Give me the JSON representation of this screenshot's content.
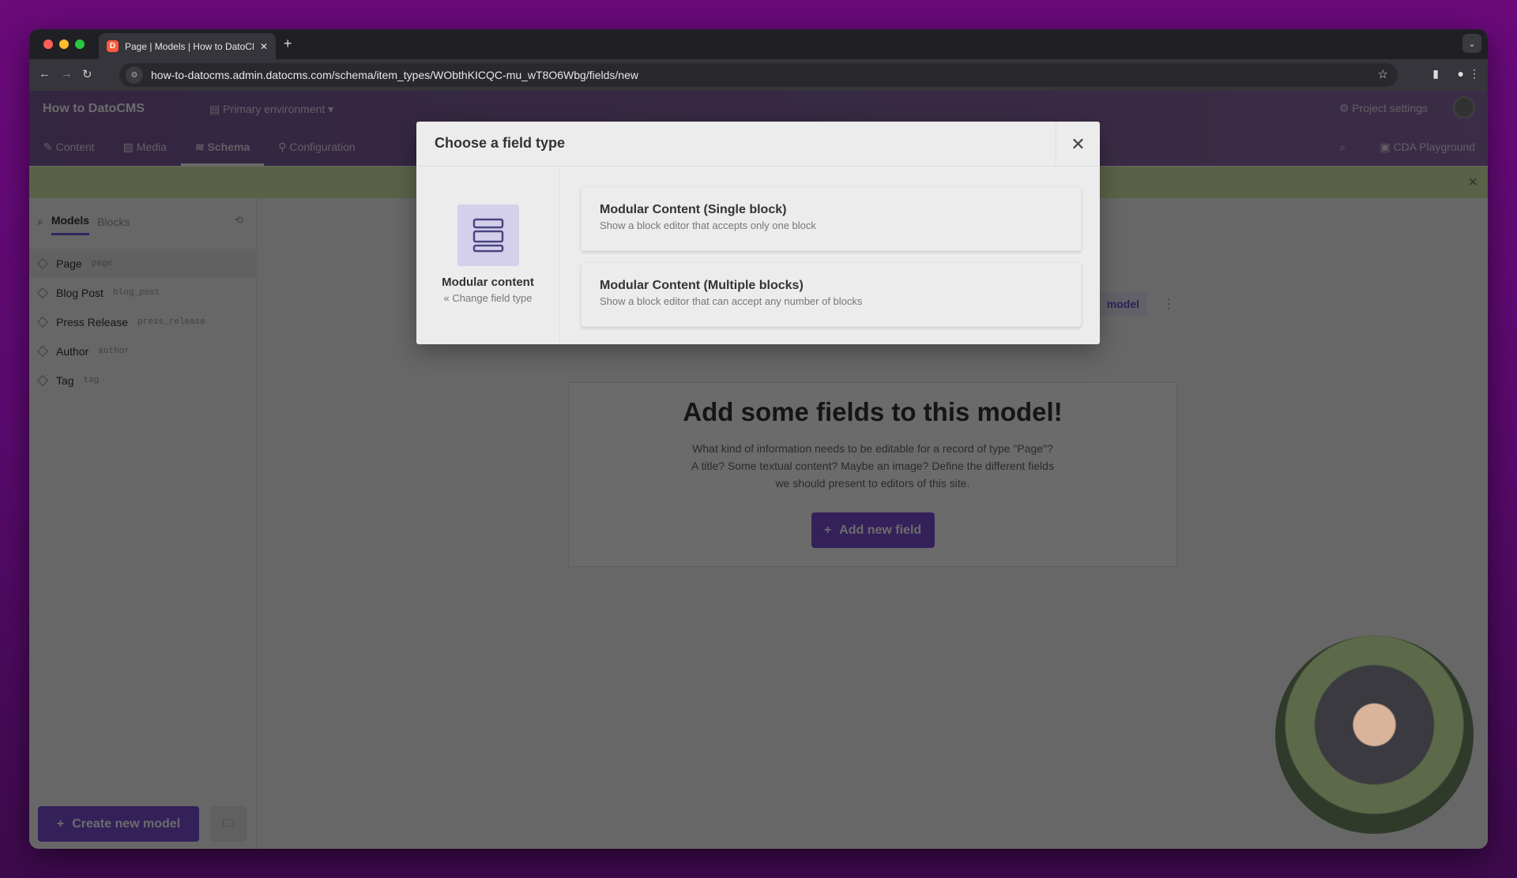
{
  "browser": {
    "tab_title": "Page | Models | How to DatoCMS",
    "favicon": "D",
    "new_tab": "+",
    "url": "how-to-datocms.admin.datocms.com/schema/item_types/WObthKICQC-mu_wT8O6Wbg/fields/new",
    "colors": {
      "close": "#ff5f57",
      "minimize": "#febc2e",
      "maximize": "#28c840"
    }
  },
  "header": {
    "project": "How to DatoCMS",
    "environment": "Primary environment",
    "project_settings": "Project settings",
    "cda_playground": "CDA Playground"
  },
  "nav": {
    "tabs": [
      {
        "label": "Content"
      },
      {
        "label": "Media"
      },
      {
        "label": "Schema"
      },
      {
        "label": "Configuration"
      }
    ]
  },
  "sidebar": {
    "tabs": [
      "Models",
      "Blocks"
    ],
    "items": [
      {
        "name": "Page",
        "api": "page"
      },
      {
        "name": "Blog Post",
        "api": "blog_post"
      },
      {
        "name": "Press Release",
        "api": "press_release"
      },
      {
        "name": "Author",
        "api": "author"
      },
      {
        "name": "Tag",
        "api": "tag"
      }
    ],
    "create_label": "Create new model"
  },
  "main": {
    "model_button": "model",
    "empty_title": "Add some fields to this model!",
    "empty_text": "What kind of information needs to be editable for a record of type \"Page\"? A title? Some textual content? Maybe an image? Define the different fields we should present to editors of this site.",
    "add_field": "Add new field"
  },
  "modal": {
    "title": "Choose a field type",
    "selected_type": "Modular content",
    "change_link": "« Change field type",
    "options": [
      {
        "title": "Modular Content (Single block)",
        "desc": "Show a block editor that accepts only one block"
      },
      {
        "title": "Modular Content (Multiple blocks)",
        "desc": "Show a block editor that can accept any number of blocks"
      }
    ]
  },
  "accent": "#7b4fd6"
}
